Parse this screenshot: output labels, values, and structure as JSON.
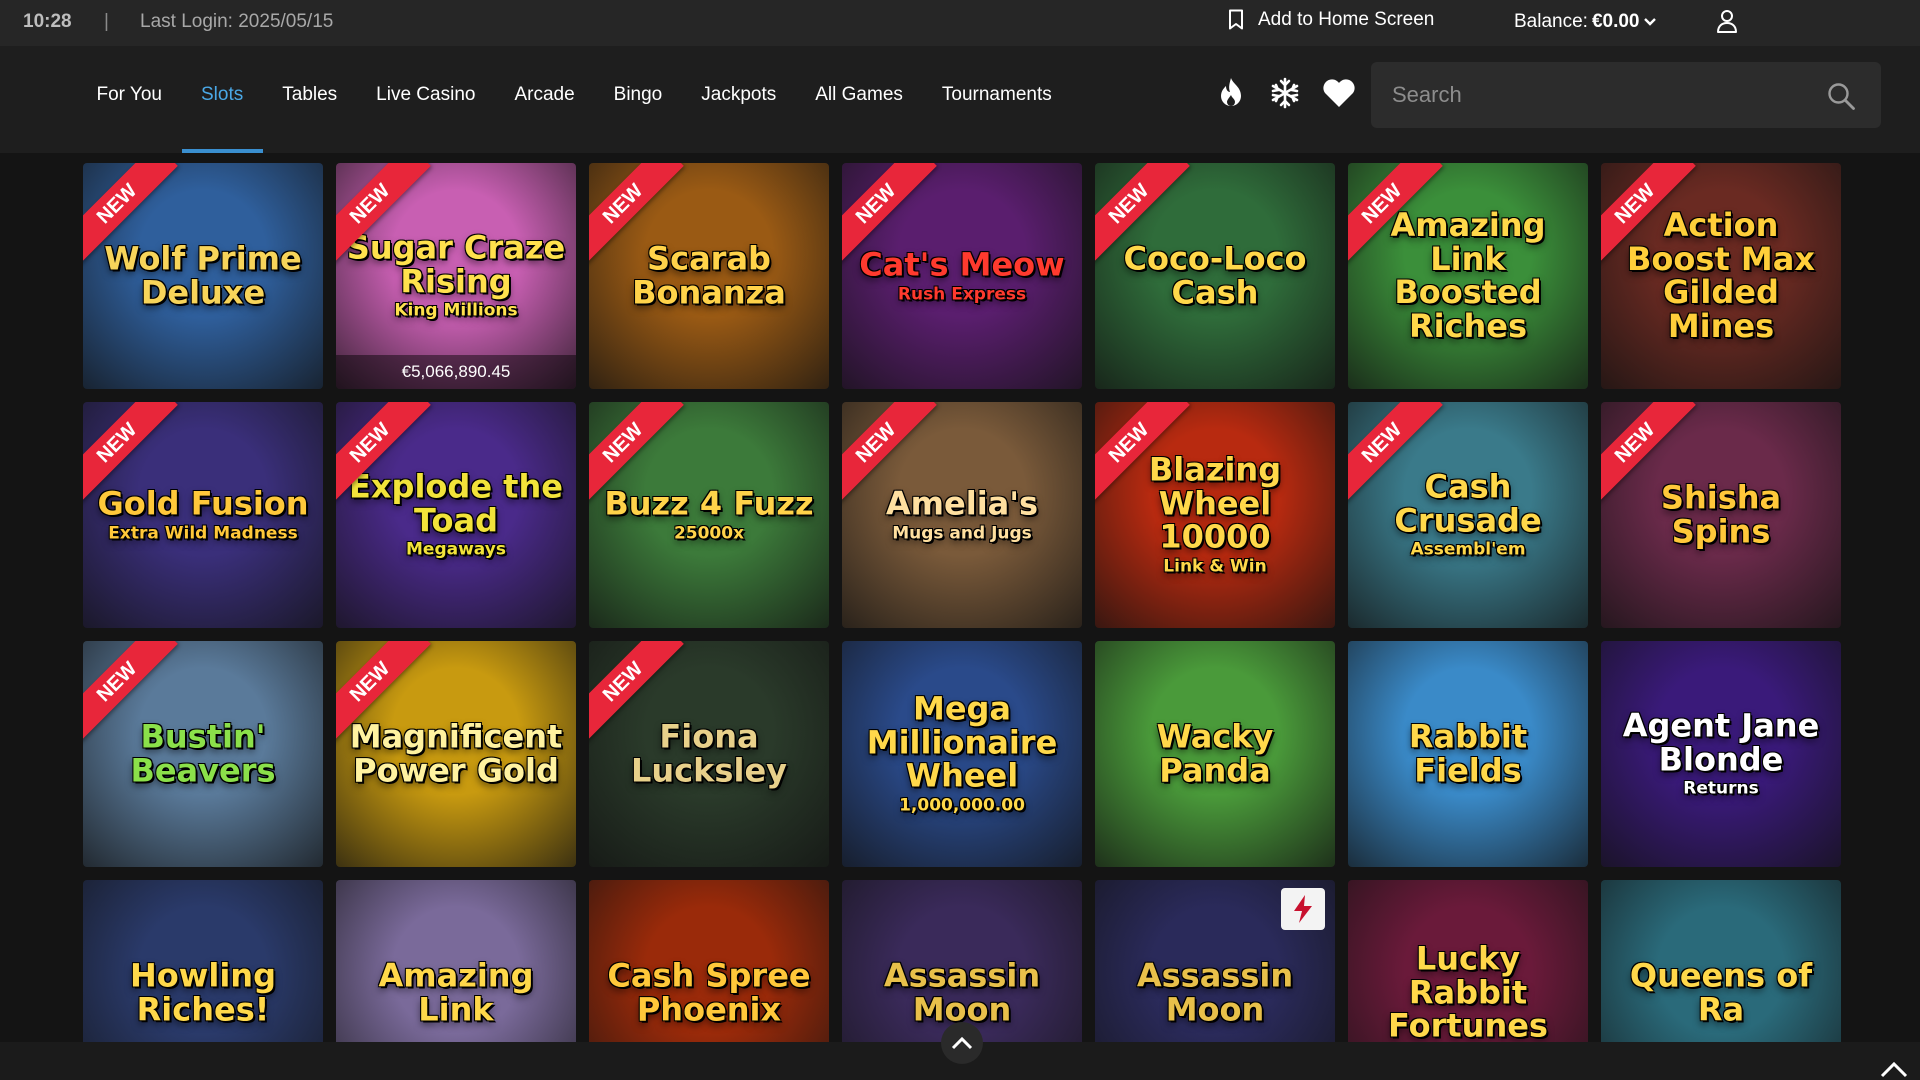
{
  "status_bar": {
    "time": "10:28",
    "separator": "|",
    "last_login": "Last Login: 2025/05/15",
    "add_to_home": "Add to Home Screen",
    "balance_label": "Balance:",
    "balance_value": "€0.00"
  },
  "nav": {
    "tabs": [
      {
        "label": "For You"
      },
      {
        "label": "Slots"
      },
      {
        "label": "Tables"
      },
      {
        "label": "Live Casino"
      },
      {
        "label": "Arcade"
      },
      {
        "label": "Bingo"
      },
      {
        "label": "Jackpots"
      },
      {
        "label": "All Games"
      },
      {
        "label": "Tournaments"
      }
    ],
    "active_tab": "Slots",
    "quick_icons": [
      "flame-icon",
      "snowflake-icon",
      "heart-icon"
    ]
  },
  "search": {
    "placeholder": "Search"
  },
  "badge_label": "NEW",
  "games": [
    {
      "title": "Wolf Prime Deluxe",
      "new": true,
      "bg": "#2f5f9c",
      "fg": "#f7d45a"
    },
    {
      "title": "Sugar Craze Rising",
      "subtitle": "King Millions",
      "new": true,
      "bg": "#c85fb2",
      "fg": "#ffe14d",
      "jackpot": "€5,066,890.45"
    },
    {
      "title": "Scarab Bonanza",
      "new": true,
      "bg": "#9a5a14",
      "fg": "#ffd34a"
    },
    {
      "title": "Cat's Meow",
      "subtitle": "Rush Express",
      "new": true,
      "bg": "#5a1e6e",
      "fg": "#ff3a2e"
    },
    {
      "title": "Coco-Loco Cash",
      "new": true,
      "bg": "#2f6c3a",
      "fg": "#ffd84a"
    },
    {
      "title": "Amazing Link Boosted Riches",
      "new": true,
      "bg": "#3b8f3a",
      "fg": "#ffd84a"
    },
    {
      "title": "Action Boost Max Gilded Mines",
      "new": true,
      "bg": "#6a2a22",
      "fg": "#ffcf3a"
    },
    {
      "title": "Gold Fusion",
      "subtitle": "Extra Wild Madness",
      "new": true,
      "bg": "#3a2f7a",
      "fg": "#ffc83a"
    },
    {
      "title": "Explode the Toad",
      "subtitle": "Megaways",
      "new": true,
      "bg": "#4a2a8a",
      "fg": "#f2e33a"
    },
    {
      "title": "Buzz 4 Fuzz",
      "subtitle": "25000x",
      "new": true,
      "bg": "#3c7a3a",
      "fg": "#ffd34a"
    },
    {
      "title": "Amelia's",
      "subtitle": "Mugs and Jugs",
      "new": true,
      "bg": "#7a5a3a",
      "fg": "#ffe0a0"
    },
    {
      "title": "Blazing Wheel 10000",
      "subtitle": "Link & Win",
      "new": true,
      "bg": "#b82a10",
      "fg": "#ffd84a"
    },
    {
      "title": "Cash Crusade",
      "subtitle": "Assembl'em",
      "new": true,
      "bg": "#3a7a8a",
      "fg": "#ffd84a"
    },
    {
      "title": "Shisha Spins",
      "new": true,
      "bg": "#6a2a4a",
      "fg": "#ffc83a"
    },
    {
      "title": "Bustin' Beavers",
      "new": true,
      "bg": "#5a7a9a",
      "fg": "#8be04a"
    },
    {
      "title": "Magnificent Power Gold",
      "new": true,
      "bg": "#c89a10",
      "fg": "#fff2a0"
    },
    {
      "title": "Fiona Lucksley",
      "new": true,
      "bg": "#2a3a2a",
      "fg": "#e8d08a"
    },
    {
      "title": "Mega Millionaire Wheel",
      "subtitle": "1,000,000.00",
      "new": false,
      "bg": "#2a4a8a",
      "fg": "#ffd84a"
    },
    {
      "title": "Wacky Panda",
      "new": false,
      "bg": "#4a9a3a",
      "fg": "#ffd84a"
    },
    {
      "title": "Rabbit Fields",
      "new": false,
      "bg": "#3a8ac8",
      "fg": "#ffd84a"
    },
    {
      "title": "Agent Jane Blonde",
      "subtitle": "Returns",
      "new": false,
      "bg": "#3a1a7a",
      "fg": "#ffffff"
    },
    {
      "title": "Howling Riches!",
      "new": false,
      "bg": "#2a3a6a",
      "fg": "#ffd84a"
    },
    {
      "title": "Amazing Link",
      "new": false,
      "bg": "#7a6a9a",
      "fg": "#ffd84a"
    },
    {
      "title": "Cash Spree Phoenix",
      "new": false,
      "bg": "#9a2a0a",
      "fg": "#ffc83a"
    },
    {
      "title": "Assassin Moon",
      "new": false,
      "bg": "#3a2a5a",
      "fg": "#e8c04a"
    },
    {
      "title": "Assassin Moon",
      "new": false,
      "bg": "#2a2a5a",
      "fg": "#e8c04a",
      "lightning": true
    },
    {
      "title": "Lucky Rabbit Fortunes",
      "new": false,
      "bg": "#6a1a3a",
      "fg": "#ffd84a"
    },
    {
      "title": "Queens of Ra",
      "new": false,
      "bg": "#2a6a7a",
      "fg": "#ffd84a"
    }
  ],
  "colors": {
    "accent": "#3a8fd0",
    "new_badge": "#e8263a",
    "topbar": "#262626",
    "navbar": "#1e1e1e",
    "page": "#141414"
  },
  "icons": {
    "bookmark": "bookmark-icon",
    "balance_caret": "chevron-down-icon",
    "user": "user-icon",
    "search": "search-icon",
    "scroll_up": "chevron-up-icon"
  }
}
